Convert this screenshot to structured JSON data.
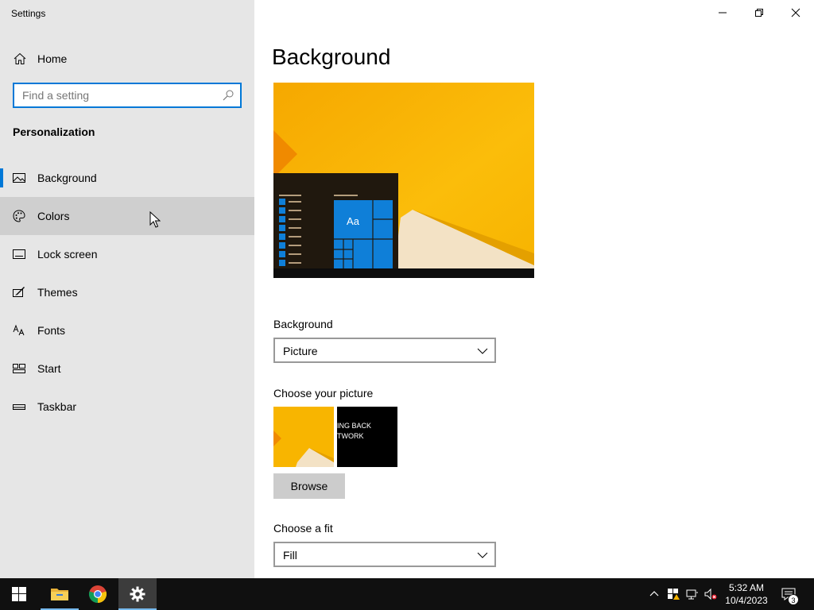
{
  "window": {
    "app_title": "Settings",
    "controls": {
      "minimize": "minimize-icon",
      "restore": "restore-icon",
      "close": "close-icon"
    }
  },
  "sidebar": {
    "home_label": "Home",
    "search_placeholder": "Find a setting",
    "section_title": "Personalization",
    "items": [
      {
        "label": "Background",
        "icon": "picture-icon",
        "selected": true
      },
      {
        "label": "Colors",
        "icon": "palette-icon",
        "hover": true
      },
      {
        "label": "Lock screen",
        "icon": "lock-screen-icon"
      },
      {
        "label": "Themes",
        "icon": "themes-icon"
      },
      {
        "label": "Fonts",
        "icon": "fonts-icon"
      },
      {
        "label": "Start",
        "icon": "start-icon"
      },
      {
        "label": "Taskbar",
        "icon": "taskbar-icon"
      }
    ]
  },
  "main": {
    "page_title": "Background",
    "preview": {
      "tile_label": "Aa"
    },
    "background": {
      "label": "Background",
      "value": "Picture"
    },
    "choose_picture": {
      "label": "Choose your picture",
      "thumb2_text_line1": "ING BACK",
      "thumb2_text_line2": "TWORK"
    },
    "browse_label": "Browse",
    "fit": {
      "label": "Choose a fit",
      "value": "Fill"
    }
  },
  "taskbar": {
    "clock_time": "5:32 AM",
    "clock_date": "10/4/2023",
    "notification_count": "3"
  },
  "colors": {
    "accent": "#0078d7",
    "wallpaper_yellow": "#f8b500",
    "sidebar_bg": "#e6e6e6",
    "taskbar_bg": "#101010"
  }
}
